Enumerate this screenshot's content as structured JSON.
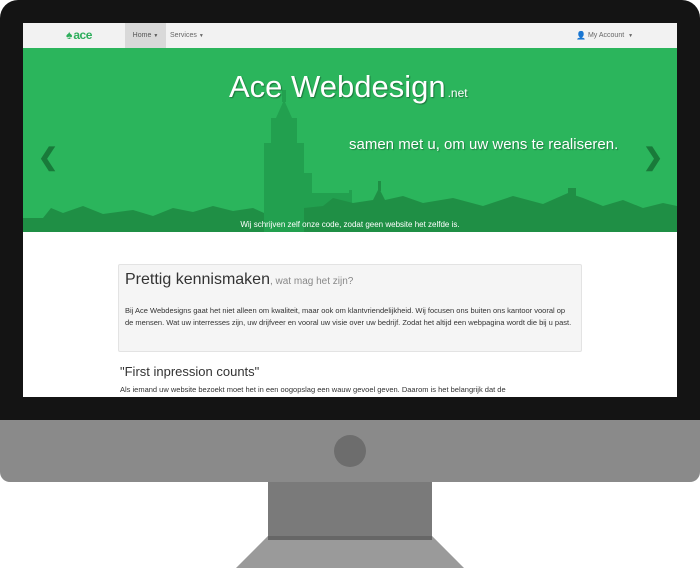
{
  "navbar": {
    "brand": "ace",
    "home_label": "Home",
    "services_label": "Services",
    "account_label": "My Account"
  },
  "hero": {
    "title": "Ace Webdesign",
    "title_suffix": ".net",
    "subtitle": "samen met u, om uw wens te realiseren.",
    "caption": "Wij schrijven zelf onze code, zodat geen website het zelfde is.",
    "prev_arrow": "❮",
    "next_arrow": "❯"
  },
  "intro": {
    "heading": "Prettig kennismaken",
    "heading_small": ", wat mag het zijn?",
    "body": "Bij Ace Webdesigns gaat het niet alleen om kwaliteit, maar ook om klantvriendelijkheid. Wij focusen ons buiten ons kantoor vooral op de mensen. Wat uw interresses zijn, uw drijfveer en vooral uw visie over uw bedrijf. Zodat het altijd een webpagina wordt die bij u past."
  },
  "section": {
    "heading": "\"First inpression counts\"",
    "body": "Als iemand uw website bezoekt moet het in een oogopslag een wauw gevoel geven. Daarom is het belangrijk dat de"
  },
  "colors": {
    "brand_green": "#2bb55c",
    "dark_green": "#1f8f45",
    "bezel": "#141414",
    "stand": "#8a8a8a"
  },
  "icons": {
    "brand": "spade-icon",
    "user": "user-icon",
    "prev": "chevron-left-icon",
    "next": "chevron-right-icon"
  }
}
